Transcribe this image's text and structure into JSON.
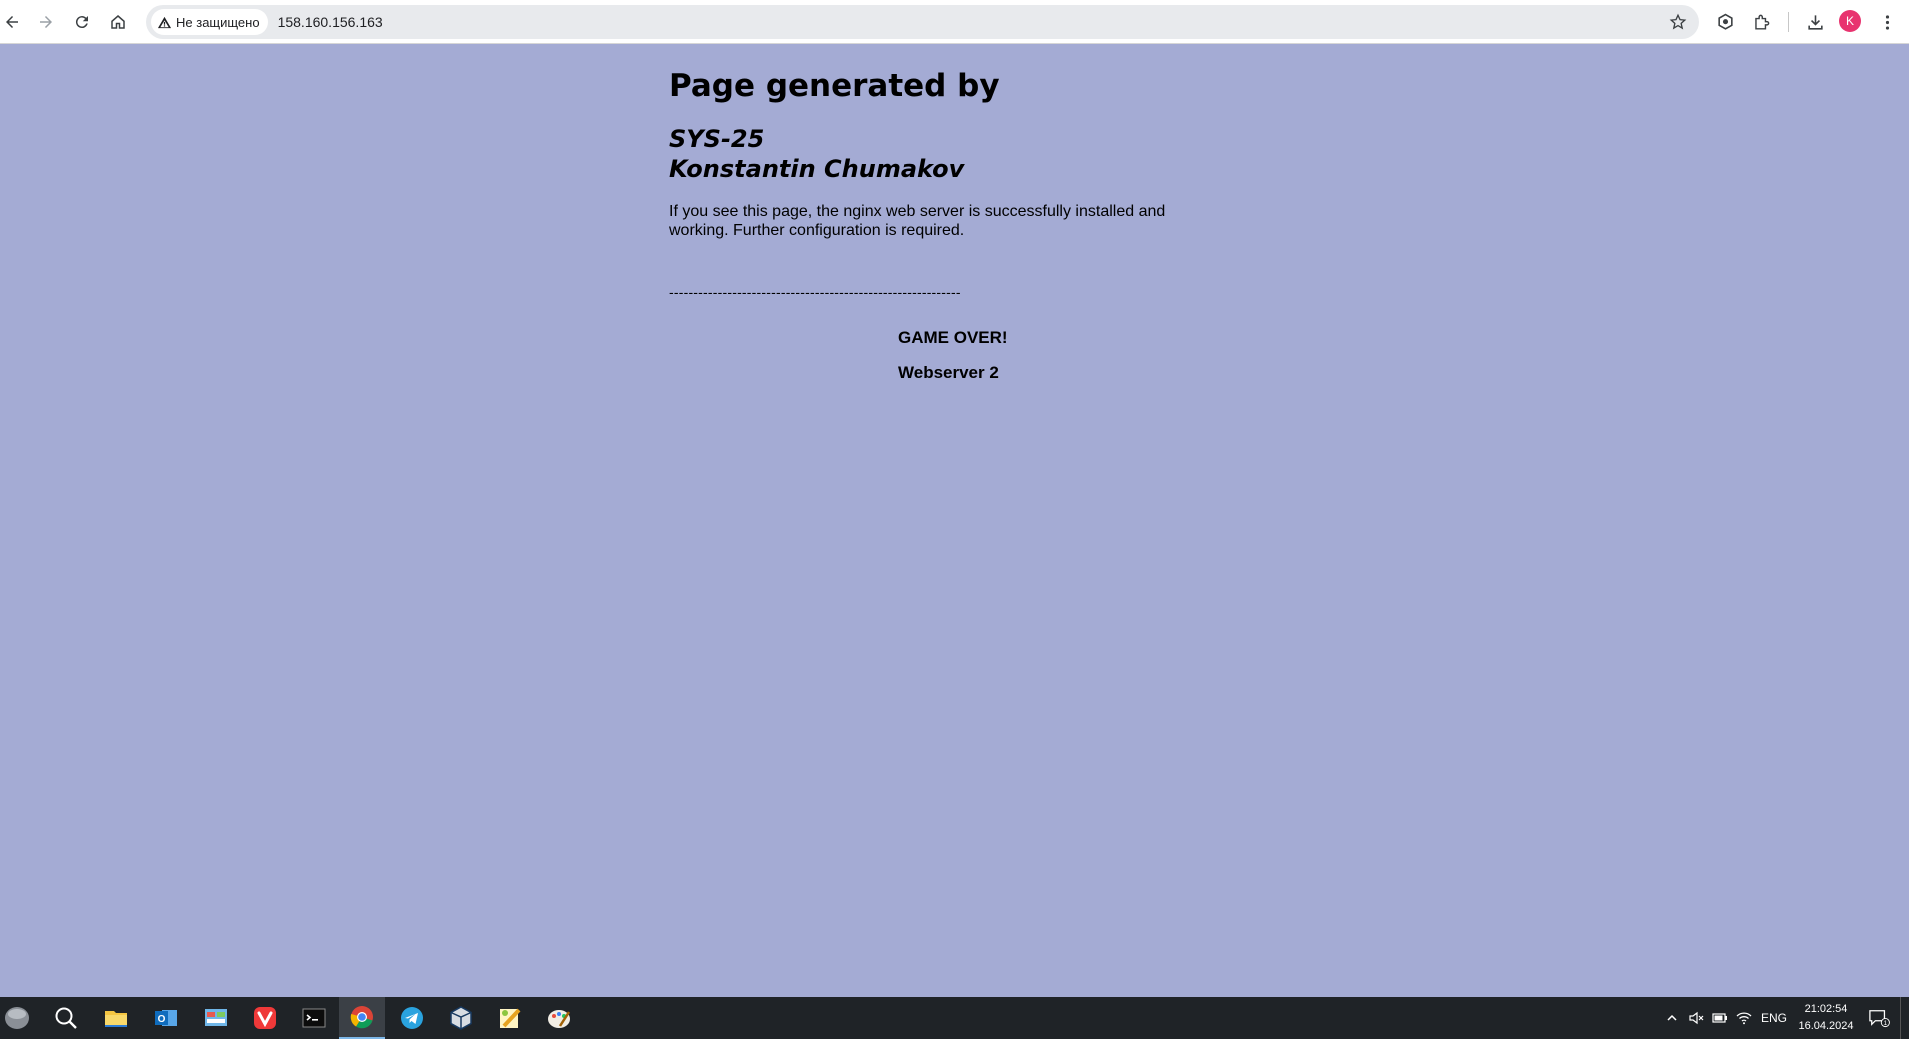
{
  "browser": {
    "security_label": "Не защищено",
    "url": "158.160.156.163",
    "profile_initial": "K"
  },
  "page": {
    "heading": "Page generated by",
    "subheading_line1": "SYS-25",
    "subheading_line2": "Konstantin Chumakov",
    "message": "If you see this page, the nginx web server is successfully installed and working. Further configuration is required.",
    "divider": "------------------------------------------------------------",
    "game_over": "GAME OVER!",
    "webserver": "Webserver 2",
    "background_color": "#a4abd4"
  },
  "taskbar": {
    "apps": [
      "start-orb",
      "search",
      "file-explorer",
      "outlook",
      "control-panel",
      "vivaldi",
      "terminal",
      "chrome",
      "telegram",
      "virtualbox",
      "notepad-plus",
      "paint"
    ],
    "active_app": "chrome",
    "language": "ENG",
    "time": "21:02:54",
    "date": "16.04.2024",
    "notification_count": "1"
  }
}
